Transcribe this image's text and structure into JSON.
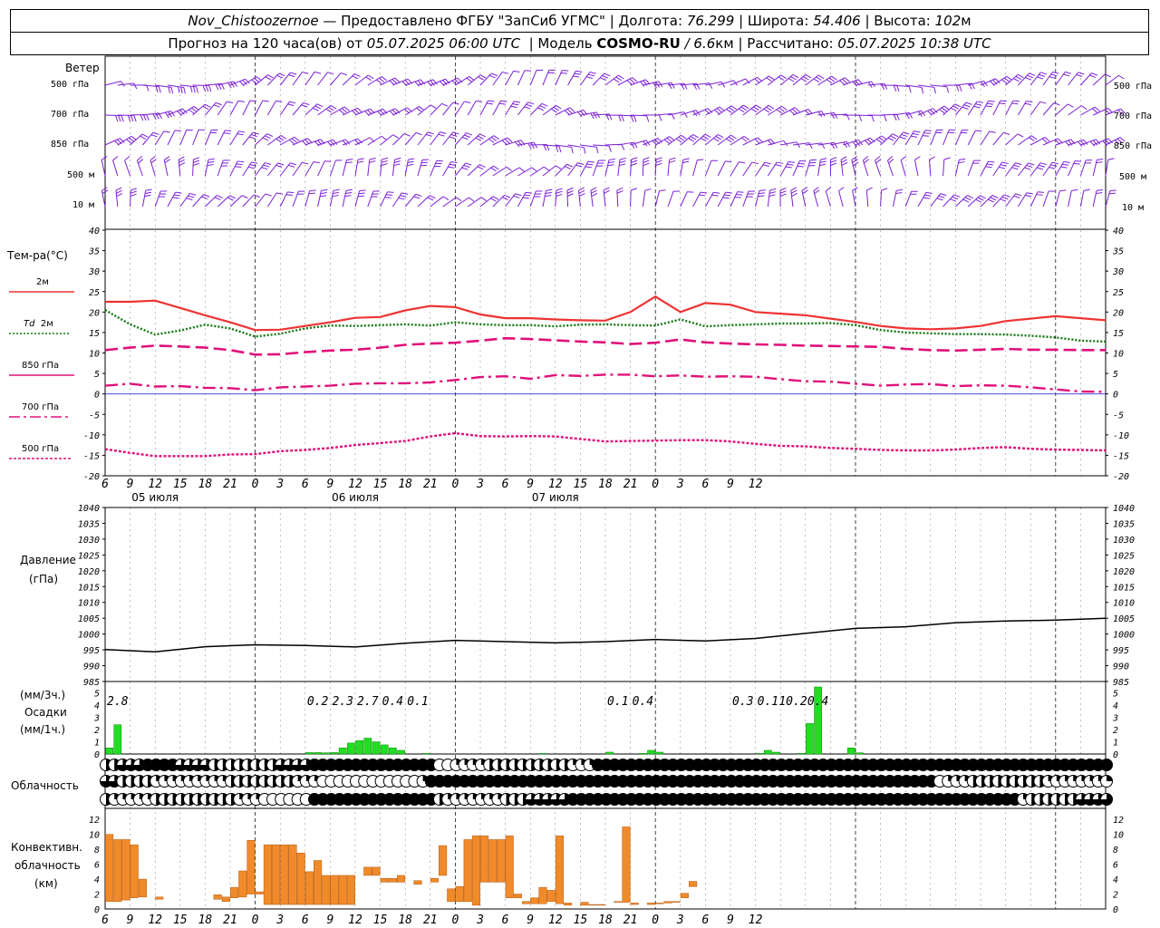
{
  "header": {
    "station": "Nov_Chistoozernoe",
    "provider": "— Предоставлено ФГБУ \"ЗапСиб УГМС\"",
    "lon_label": "Долгота:",
    "lon": "76.299",
    "lat_label": "Широта:",
    "lat": "54.406",
    "alt_label": "Высота:",
    "alt": "102",
    "alt_unit": "м",
    "forecast_prefix": "Прогноз на 120 часа(ов) от",
    "forecast_date": "05.07.2025 06:00 UTC",
    "model_label": "Модель",
    "model": "COSMO-RU",
    "model_res": "/ 6.6",
    "model_res_unit": "км",
    "calc_label": "Рассчитано:",
    "calc_date": "05.07.2025 10:38 UTC"
  },
  "labels": {
    "wind": "Ветер",
    "levels": [
      "500 гПа",
      "700 гПа",
      "850 гПа",
      "500  м",
      "10  м"
    ],
    "temp": "Тем-ра(°C)",
    "t2m": "2м",
    "td": "Td",
    "td2m": "2м",
    "t850": "850 гПа",
    "t700": "700 гПа",
    "t500": "500 гПа",
    "pressure": "Давление",
    "pressure_unit": "(гПа)",
    "precip_unit3": "(мм/3ч.)",
    "precip": "Осадки",
    "precip_unit1": "(мм/1ч.)",
    "cloud": "Облачность",
    "conv1": "Конвективн.",
    "conv2": "облачность",
    "conv3": "(км)",
    "days": [
      "05 июля",
      "06 июля",
      "07 июля"
    ]
  },
  "colors": {
    "wind": "#7b1fd6",
    "t2m": "#ee3333",
    "td": "#117711",
    "t850": "#e0107a",
    "t700": "#e0107a",
    "t500": "#e0107a",
    "precip": "#22dd22",
    "conv": "#f08a2a",
    "zero": "#3333dd"
  },
  "chart_data": [
    {
      "type": "line",
      "title": "Тем-ра(°C)",
      "ylim": [
        -20,
        40
      ],
      "yticks": [
        40,
        35,
        30,
        25,
        20,
        15,
        10,
        5,
        0,
        -5,
        -10,
        -15,
        -20
      ],
      "x_hours": [
        0,
        3,
        6,
        9,
        12,
        15,
        18,
        21,
        24,
        27,
        30,
        33,
        36,
        39,
        42,
        45,
        48,
        51,
        54,
        57,
        60,
        63,
        66,
        69,
        72,
        75,
        78,
        81,
        84,
        87,
        90,
        93,
        96,
        99,
        102,
        105,
        108,
        111,
        114,
        117,
        120
      ],
      "x_tick_labels": [
        "6",
        "9",
        "12",
        "15",
        "18",
        "21",
        "0",
        "3",
        "6",
        "9",
        "12",
        "15",
        "18",
        "21",
        "0",
        "3",
        "6",
        "9",
        "12",
        "15",
        "18",
        "21",
        "0",
        "3",
        "6",
        "9",
        "12"
      ],
      "series": [
        {
          "name": "2м",
          "values": [
            22.5,
            22.5,
            22.8,
            21.0,
            19.2,
            17.5,
            15.6,
            15.7,
            16.6,
            17.5,
            18.6,
            18.8,
            20.4,
            21.5,
            21.2,
            19.4,
            18.5,
            18.5,
            18.2,
            18.0,
            17.9,
            20.0,
            23.8,
            20.0,
            22.2,
            21.8,
            20.0,
            19.6,
            19.2,
            18.4,
            17.6,
            16.6,
            16.0,
            15.8,
            16.0,
            16.6,
            17.8,
            18.4,
            19.0,
            18.5,
            18.0
          ]
        },
        {
          "name": "Td 2м",
          "values": [
            20.5,
            17.0,
            14.5,
            15.5,
            16.9,
            16.0,
            14.0,
            14.7,
            16.0,
            16.7,
            16.6,
            16.8,
            17.0,
            16.7,
            17.5,
            17.0,
            16.8,
            16.8,
            16.5,
            16.9,
            17.0,
            16.8,
            16.7,
            18.2,
            16.5,
            16.8,
            17.0,
            17.2,
            17.2,
            17.3,
            16.8,
            15.6,
            15.0,
            14.8,
            14.6,
            14.6,
            14.5,
            14.2,
            13.8,
            13.0,
            12.8
          ]
        },
        {
          "name": "850 гПа",
          "values": [
            10.7,
            11.3,
            11.8,
            11.6,
            11.3,
            10.7,
            9.6,
            9.7,
            10.2,
            10.6,
            10.8,
            11.3,
            12.0,
            12.3,
            12.5,
            13.0,
            13.6,
            13.4,
            13.1,
            12.8,
            12.6,
            12.2,
            12.5,
            13.3,
            12.6,
            12.3,
            12.1,
            12.0,
            11.8,
            11.7,
            11.6,
            11.5,
            11.0,
            10.7,
            10.6,
            10.8,
            11.0,
            10.8,
            10.8,
            10.7,
            10.7
          ]
        },
        {
          "name": "700 гПа",
          "values": [
            2.0,
            2.5,
            1.8,
            1.9,
            1.5,
            1.4,
            0.9,
            1.6,
            1.8,
            2.0,
            2.5,
            2.6,
            2.6,
            2.8,
            3.4,
            4.1,
            4.3,
            3.7,
            4.6,
            4.4,
            4.7,
            4.7,
            4.3,
            4.5,
            4.2,
            4.3,
            4.2,
            3.6,
            3.1,
            3.0,
            2.5,
            2.0,
            2.3,
            2.4,
            1.9,
            2.1,
            2.0,
            1.6,
            1.1,
            0.6,
            0.5
          ]
        },
        {
          "name": "500 гПа",
          "values": [
            -13.5,
            -14.4,
            -15.2,
            -15.2,
            -15.2,
            -14.8,
            -14.7,
            -14.0,
            -13.7,
            -13.2,
            -12.5,
            -12.0,
            -11.5,
            -10.4,
            -9.6,
            -10.3,
            -10.4,
            -10.3,
            -10.4,
            -11.0,
            -11.6,
            -11.5,
            -11.4,
            -11.3,
            -11.3,
            -11.6,
            -12.2,
            -12.7,
            -12.8,
            -13.2,
            -13.4,
            -13.7,
            -13.8,
            -13.8,
            -13.6,
            -13.2,
            -13.0,
            -13.4,
            -13.6,
            -13.7,
            -13.8
          ]
        }
      ]
    },
    {
      "type": "line",
      "title": "Давление (гПа)",
      "ylim": [
        985,
        1040
      ],
      "yticks": [
        1040,
        1035,
        1030,
        1025,
        1020,
        1015,
        1010,
        1005,
        1000,
        995,
        990,
        985
      ],
      "x_hours": [
        0,
        6,
        12,
        18,
        24,
        30,
        36,
        42,
        48,
        54,
        60,
        66,
        72,
        78,
        84,
        90,
        96,
        102,
        108,
        114,
        120
      ],
      "series": [
        {
          "name": "Давление",
          "values": [
            995.1,
            994.4,
            996.0,
            996.6,
            996.4,
            995.9,
            997.1,
            998.0,
            997.6,
            997.2,
            997.6,
            998.3,
            997.8,
            998.6,
            1000.2,
            1001.8,
            1002.3,
            1003.6,
            1004.1,
            1004.4,
            1005.0
          ]
        }
      ]
    },
    {
      "type": "bar",
      "title": "Осадки",
      "ylim": [
        0,
        5.5
      ],
      "yticks": [
        5,
        4,
        3,
        2,
        1,
        0
      ],
      "bars": [
        [
          0,
          0.5
        ],
        [
          1,
          2.4
        ],
        [
          24,
          0.12
        ],
        [
          25,
          0.12
        ],
        [
          26,
          0.1
        ],
        [
          27,
          0.12
        ],
        [
          28,
          0.5
        ],
        [
          29,
          0.9
        ],
        [
          30,
          1.1
        ],
        [
          31,
          1.3
        ],
        [
          32,
          1.0
        ],
        [
          33,
          0.75
        ],
        [
          34,
          0.5
        ],
        [
          35,
          0.3
        ],
        [
          38,
          0.05
        ],
        [
          52,
          0.05
        ],
        [
          60,
          0.15
        ],
        [
          64,
          0.05
        ],
        [
          65,
          0.3
        ],
        [
          66,
          0.15
        ],
        [
          78,
          0.05
        ],
        [
          79,
          0.3
        ],
        [
          80,
          0.15
        ],
        [
          83,
          0.05
        ],
        [
          84,
          2.5
        ],
        [
          85,
          5.8
        ],
        [
          89,
          0.5
        ],
        [
          90,
          0.1
        ]
      ],
      "totals": [
        {
          "hour": 1.5,
          "label": "2.8"
        },
        {
          "hour": 25.5,
          "label": "0.2"
        },
        {
          "hour": 28.5,
          "label": "2.3"
        },
        {
          "hour": 31.5,
          "label": "2.7"
        },
        {
          "hour": 34.5,
          "label": "0.4"
        },
        {
          "hour": 37.5,
          "label": "0.1"
        },
        {
          "hour": 61.5,
          "label": "0.1"
        },
        {
          "hour": 64.5,
          "label": "0.4"
        },
        {
          "hour": 76.5,
          "label": "0.3"
        },
        {
          "hour": 79.5,
          "label": "0.1"
        },
        {
          "hour": 82.5,
          "label": "10.2"
        },
        {
          "hour": 85.5,
          "label": "0.4"
        }
      ]
    },
    {
      "type": "bar",
      "title": "Конвективн. облачность (км)",
      "ylim": [
        0,
        13
      ],
      "yticks": [
        12,
        10,
        8,
        6,
        4,
        2,
        0
      ],
      "bars": [
        [
          0,
          1,
          10
        ],
        [
          1,
          1,
          9.3
        ],
        [
          2,
          1.2,
          9.3
        ],
        [
          3,
          1.5,
          8.6
        ],
        [
          4,
          1.6,
          4.0
        ],
        [
          6,
          1.3,
          1.6
        ],
        [
          13,
          1.3,
          1.9
        ],
        [
          14,
          1.0,
          1.6
        ],
        [
          15,
          1.5,
          2.9
        ],
        [
          16,
          1.6,
          5.1
        ],
        [
          17,
          2.0,
          9.2
        ],
        [
          18,
          2.0,
          2.3
        ],
        [
          19,
          0.6,
          8.6
        ],
        [
          20,
          0.6,
          8.6
        ],
        [
          21,
          0.6,
          8.6
        ],
        [
          22,
          0.6,
          8.6
        ],
        [
          23,
          0.6,
          7.5
        ],
        [
          24,
          0.6,
          5.0
        ],
        [
          25,
          0.6,
          6.5
        ],
        [
          26,
          0.6,
          4.5
        ],
        [
          27,
          0.6,
          4.5
        ],
        [
          28,
          0.6,
          4.5
        ],
        [
          29,
          0.6,
          4.5
        ],
        [
          31,
          4.5,
          5.6
        ],
        [
          32,
          4.5,
          5.6
        ],
        [
          33,
          3.6,
          4.1
        ],
        [
          34,
          3.6,
          4.1
        ],
        [
          35,
          3.6,
          4.5
        ],
        [
          37,
          3.3,
          3.8
        ],
        [
          39,
          3.6,
          4.1
        ],
        [
          40,
          4.5,
          8.5
        ],
        [
          41,
          1.0,
          2.7
        ],
        [
          42,
          1.0,
          3.0
        ],
        [
          43,
          1.0,
          9.3
        ],
        [
          44,
          0.5,
          9.8
        ],
        [
          45,
          3.6,
          9.8
        ],
        [
          46,
          3.6,
          9.3
        ],
        [
          47,
          3.6,
          9.3
        ],
        [
          48,
          1.5,
          9.8
        ],
        [
          49,
          1.5,
          2.0
        ],
        [
          50,
          0.7,
          1.0
        ],
        [
          51,
          0.7,
          1.5
        ],
        [
          52,
          0.7,
          2.9
        ],
        [
          53,
          1.0,
          2.5
        ],
        [
          54,
          0.7,
          9.8
        ],
        [
          55,
          0.5,
          0.8
        ],
        [
          57,
          0.5,
          0.9
        ],
        [
          58,
          0.5,
          0.6
        ],
        [
          59,
          0.5,
          0.6
        ],
        [
          60,
          0.5,
          0.5
        ],
        [
          61,
          0.9,
          1.0
        ],
        [
          62,
          0.9,
          11.0
        ],
        [
          63,
          0.6,
          0.8
        ],
        [
          64,
          0.6,
          0.6
        ],
        [
          65,
          0.6,
          0.8
        ],
        [
          66,
          0.7,
          0.8
        ],
        [
          67,
          0.8,
          1.0
        ],
        [
          68,
          0.9,
          1.0
        ],
        [
          69,
          1.5,
          2.1
        ],
        [
          70,
          3.0,
          3.7
        ]
      ]
    }
  ]
}
